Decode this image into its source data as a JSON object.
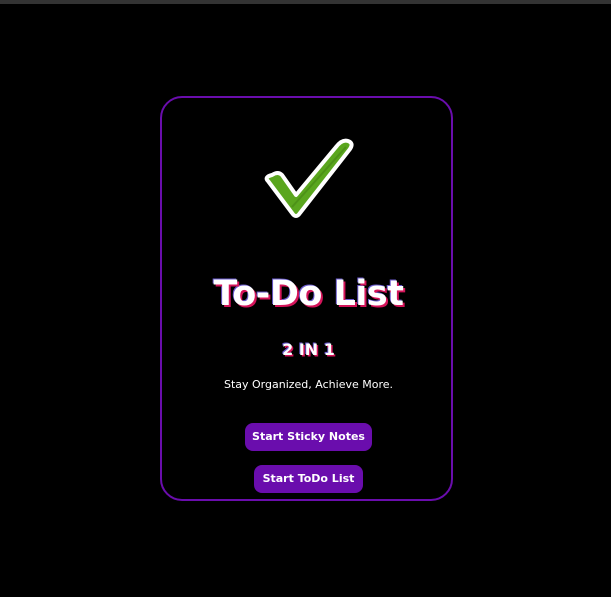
{
  "app": {
    "title": "To-Do List",
    "subtitle": "2 IN 1",
    "tagline": "Stay Organized, Achieve More."
  },
  "icons": {
    "hero": "checkmark-icon"
  },
  "buttons": {
    "sticky_notes_label": "Start Sticky Notes",
    "todo_list_label": "Start ToDo List"
  },
  "colors": {
    "background": "#000000",
    "accent": "#6a0dad",
    "check_green": "#5aa61e",
    "text": "#ffffff",
    "text_shadow_pink": "#d4145a"
  }
}
